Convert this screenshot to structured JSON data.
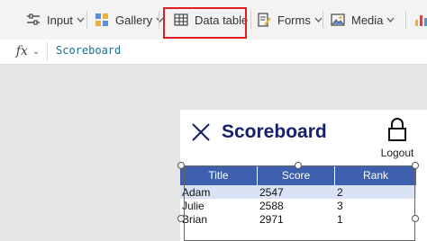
{
  "ribbon": {
    "input_label": "Input",
    "gallery_label": "Gallery",
    "datatable_label": "Data table",
    "forms_label": "Forms",
    "media_label": "Media",
    "highlight_color": "#e02020"
  },
  "formula_bar": {
    "fx_label": "fx",
    "formula": "Scoreboard"
  },
  "screen": {
    "title": "Scoreboard",
    "logout_label": "Logout",
    "title_color": "#17206b"
  },
  "table": {
    "columns": [
      "Title",
      "Score",
      "Rank"
    ],
    "header_color": "#3d5fae",
    "rows": [
      {
        "title": "Adam",
        "score": "2547",
        "rank": "2"
      },
      {
        "title": "Julie",
        "score": "2588",
        "rank": "3"
      },
      {
        "title": "Brian",
        "score": "2971",
        "rank": "1"
      }
    ]
  }
}
